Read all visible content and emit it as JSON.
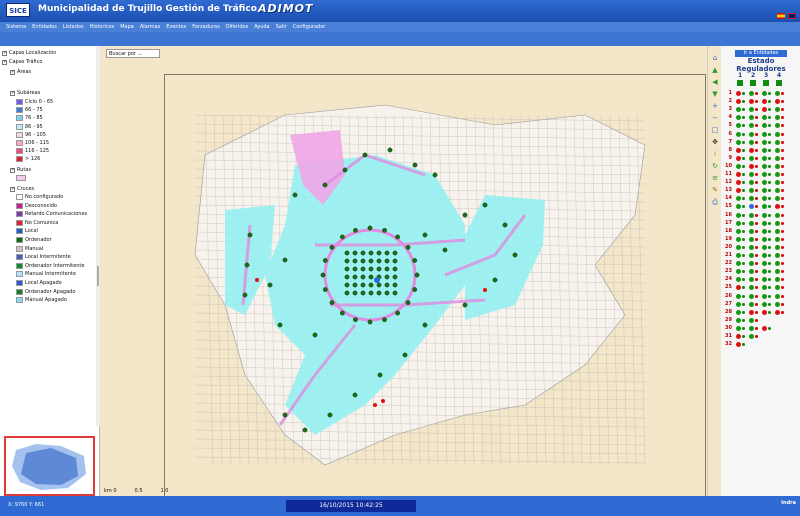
{
  "header": {
    "logo": "SICE",
    "title": "Municipalidad de Trujillo   Gestión de Tráfico",
    "brand": "ADIMOT"
  },
  "menu": [
    "Sistema",
    "Entidades",
    "Listados",
    "Históricos",
    "Mapa",
    "Alarmas",
    "Eventos",
    "Forzaduras",
    "Diferidos",
    "Ayuda",
    "Salir",
    "Configurador"
  ],
  "tree": {
    "capas_localizacion": "Capas Localización",
    "capas_trafico": "Capas Tráfico",
    "areas": "Áreas",
    "subareas": "Subáreas",
    "subarea_legend": [
      {
        "label": "Ciclo 0 - 65",
        "color": "#6c5ce7"
      },
      {
        "label": "66 - 75",
        "color": "#3f7fd0"
      },
      {
        "label": "76 - 85",
        "color": "#78d1f2"
      },
      {
        "label": "86 - 95",
        "color": "#b9eefb"
      },
      {
        "label": "96 - 105",
        "color": "#fbd3e6"
      },
      {
        "label": "106 - 115",
        "color": "#f7a6c7"
      },
      {
        "label": "116 - 125",
        "color": "#ef4a7a"
      },
      {
        "label": "> 126",
        "color": "#e0202a"
      }
    ],
    "rutas": "Rutas",
    "cruces": "Cruces",
    "cruces_legend": [
      {
        "label": "No configurado",
        "color": "#ffffff"
      },
      {
        "label": "Desconocido",
        "color": "#c81e9c"
      },
      {
        "label": "Retardo Comunicaciones",
        "color": "#7a3aa8"
      },
      {
        "label": "No Comunica",
        "color": "#e0202a"
      },
      {
        "label": "Local",
        "color": "#1d5fc9"
      },
      {
        "label": "Ordenador",
        "color": "#0d6b14"
      },
      {
        "label": "Manual",
        "color": "#c6c6c6"
      },
      {
        "label": "Local Intermitente",
        "color": "#3c63b8"
      },
      {
        "label": "Ordenador Intermitente",
        "color": "#0f8a2e"
      },
      {
        "label": "Manual Intermitente",
        "color": "#b4e1ff"
      },
      {
        "label": "Local Apagado",
        "color": "#2b5ad6"
      },
      {
        "label": "Ordenador Apagado",
        "color": "#167e2c"
      },
      {
        "label": "Manual Apagado",
        "color": "#8dd8ff"
      }
    ]
  },
  "map": {
    "search_placeholder": "Buscar por ...",
    "scale": [
      "km 0",
      "0.5",
      "1.0"
    ]
  },
  "right_panel": {
    "link": "Ir a Entidades",
    "title": "Estado Reguladores",
    "columns": [
      "1",
      "2",
      "3",
      "4"
    ],
    "rows": [
      "1",
      "2",
      "3",
      "4",
      "5",
      "6",
      "7",
      "8",
      "9",
      "10",
      "11",
      "12",
      "13",
      "14",
      "15",
      "16",
      "17",
      "18",
      "19",
      "20",
      "21",
      "22",
      "23",
      "24",
      "25",
      "26",
      "27",
      "28",
      "29",
      "30",
      "31",
      "32"
    ]
  },
  "status": {
    "coords": "X: 9760  Y: 661",
    "datetime": "16/10/2015 10:42:25",
    "vendor": "Indra"
  },
  "colors": {
    "header": "#2f6bd2",
    "map_bg": "#f3e6c9",
    "subarea": "#9feff2",
    "route": "#e8a0e8",
    "node": "#1c6b18",
    "ok": "#119a11",
    "fail": "#dd1111"
  }
}
